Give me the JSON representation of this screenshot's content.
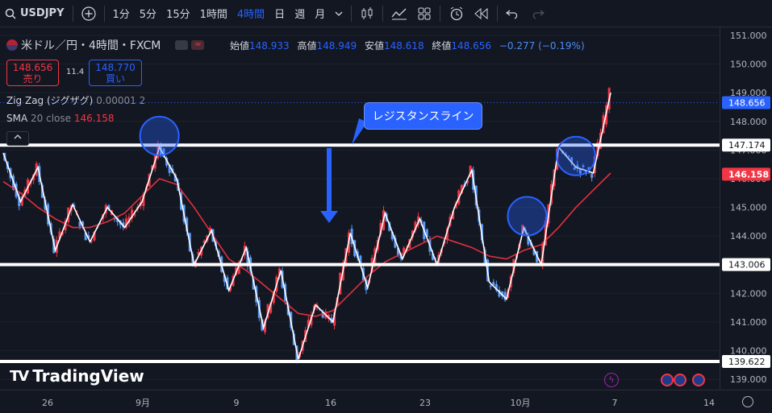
{
  "toolbar": {
    "symbol": "USDJPY",
    "intervals": [
      "1分",
      "5分",
      "15分",
      "1時間",
      "4時間",
      "日",
      "週",
      "月"
    ],
    "active_interval": "4時間"
  },
  "legend": {
    "title": "米ドル／円・4時間・FXCM",
    "open_label": "始値",
    "open": "148.933",
    "high_label": "高値",
    "high": "148.949",
    "low_label": "安値",
    "low": "148.618",
    "close_label": "終値",
    "close": "148.656",
    "change": "−0.277 (−0.19%)",
    "sell_price": "148.656",
    "sell_label": "売り",
    "spread": "11.4",
    "buy_price": "148.770",
    "buy_label": "買い",
    "zigzag_name": "Zig Zag (ジグザグ)",
    "zigzag_params": "0.00001 2",
    "sma_name": "SMA",
    "sma_params": "20 close",
    "sma_value": "146.158"
  },
  "annotation": {
    "callout_text": "レジスタンスライン"
  },
  "price_axis": {
    "ticks": [
      "151.000",
      "150.000",
      "149.000",
      "148.000",
      "147.000",
      "146.000",
      "145.000",
      "144.000",
      "143.000",
      "142.000",
      "141.000",
      "140.000",
      "139.000"
    ],
    "tags": [
      {
        "text": "148.656",
        "kind": "last"
      },
      {
        "text": "147.174",
        "kind": "line"
      },
      {
        "text": "146.158",
        "kind": "sma"
      },
      {
        "text": "143.006",
        "kind": "line"
      },
      {
        "text": "139.622",
        "kind": "line"
      }
    ]
  },
  "time_axis": {
    "labels": [
      "26",
      "9月",
      "9",
      "16",
      "23",
      "10月",
      "7",
      "14"
    ]
  },
  "watermark": "TradingView",
  "colors": {
    "up": "#f23645",
    "down": "#5b9cf6",
    "zigzag": "#ffffff",
    "sma": "#e0303f",
    "accent": "#2962ff"
  },
  "chart_data": {
    "type": "line",
    "ylim": [
      139.0,
      151.0
    ],
    "x": [
      "26",
      "9月",
      "9",
      "16",
      "23",
      "10月",
      "7",
      "14"
    ],
    "series": [
      {
        "values": [
          146.9,
          145.2,
          146.4,
          143.5,
          145.1,
          143.8,
          145.0,
          144.3,
          145.2,
          147.1,
          146.0,
          143.0,
          144.2,
          142.1,
          143.6,
          140.8,
          142.8,
          139.7,
          141.6,
          141.0,
          144.1,
          142.2,
          144.8,
          143.2,
          144.6,
          143.0,
          145.0,
          146.3,
          142.4,
          141.8,
          144.3,
          143.0,
          147.1,
          146.4,
          146.2,
          149.0
        ]
      },
      {
        "name": "SMA",
        "values": [
          145.9,
          145.5,
          145.0,
          144.6,
          144.3,
          144.3,
          144.5,
          144.8,
          145.4,
          146.0,
          145.8,
          145.0,
          144.1,
          143.2,
          142.8,
          142.3,
          141.8,
          141.3,
          141.2,
          141.4,
          142.0,
          142.6,
          143.1,
          143.4,
          143.7,
          144.0,
          143.8,
          143.6,
          143.3,
          143.2,
          143.5,
          143.7,
          144.3,
          145.0,
          145.6,
          146.2
        ]
      }
    ],
    "horizontal_lines": [
      147.174,
      143.006,
      139.622
    ]
  }
}
